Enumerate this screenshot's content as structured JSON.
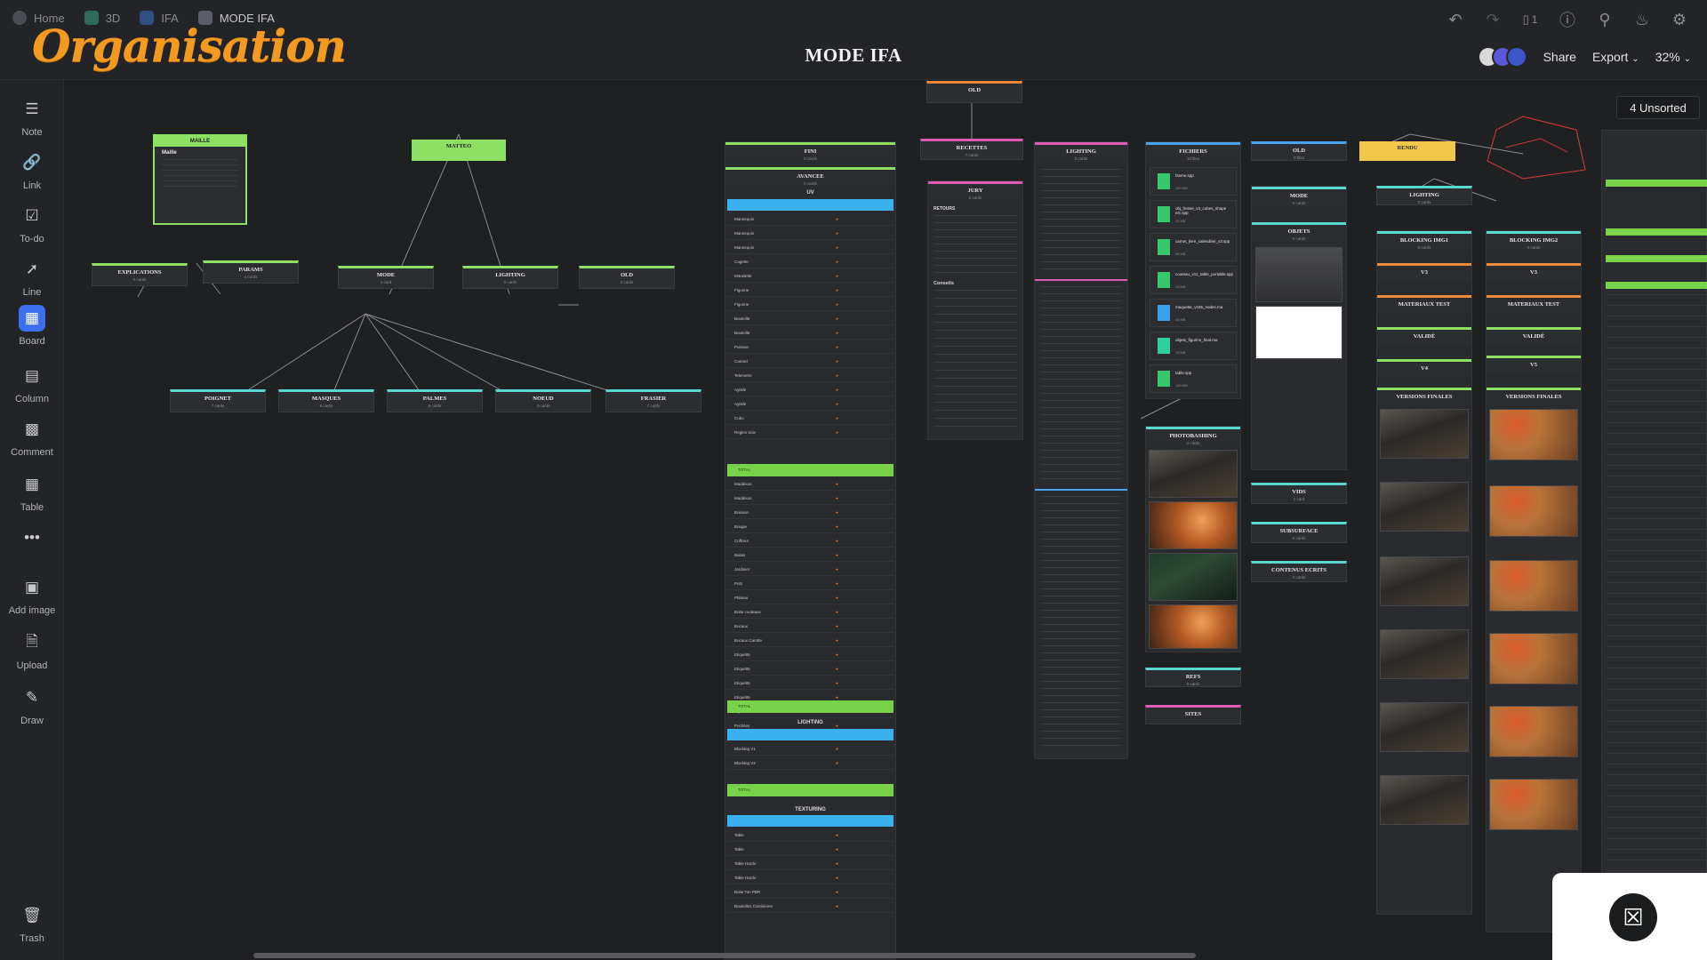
{
  "app": {
    "logo_text": "Organisation",
    "board_title": "MODE IFA",
    "breadcrumbs": [
      "Home",
      "3D",
      "IFA",
      "MODE IFA"
    ],
    "share_label": "Share",
    "export_label": "Export",
    "zoom": "32%",
    "device_count": "1",
    "unsorted_label": "4 Unsorted"
  },
  "toolbar": [
    {
      "label": "Note",
      "icon": "note-icon"
    },
    {
      "label": "Link",
      "icon": "link-icon"
    },
    {
      "label": "To-do",
      "icon": "todo-icon"
    },
    {
      "label": "Line",
      "icon": "line-icon"
    },
    {
      "label": "Board",
      "icon": "board-icon"
    },
    {
      "label": "Column",
      "icon": "column-icon"
    },
    {
      "label": "Comment",
      "icon": "comment-icon"
    },
    {
      "label": "Table",
      "icon": "table-icon"
    },
    {
      "label": "Add image",
      "icon": "add-image-icon"
    },
    {
      "label": "Upload",
      "icon": "upload-icon"
    },
    {
      "label": "Draw",
      "icon": "draw-icon"
    },
    {
      "label": "Trash",
      "icon": "trash-icon"
    }
  ],
  "mindmap": {
    "maille": {
      "title": "MAILLE",
      "sub": "Maille"
    },
    "matteo": {
      "title": "MATTEO"
    },
    "explications": {
      "title": "EXPLICATIONS",
      "sub": "0 cards"
    },
    "params": {
      "title": "PARAMS",
      "sub": "4 cards"
    },
    "mode": {
      "title": "MODE",
      "sub": "1 card"
    },
    "lighting": {
      "title": "LIGHTING",
      "sub": "0 cards"
    },
    "old": {
      "title": "OLD",
      "sub": "2 cards"
    },
    "poignet": {
      "title": "POIGNET",
      "sub": "7 cards"
    },
    "masques": {
      "title": "MASQUES",
      "sub": "8 cards"
    },
    "palmes": {
      "title": "PALMES",
      "sub": "8 cards"
    },
    "noeud": {
      "title": "NOEUD",
      "sub": "3 cards"
    },
    "frasier": {
      "title": "FRASIER",
      "sub": "7 cards"
    }
  },
  "columns": {
    "fini": {
      "title": "FINI",
      "sub": "0 cards"
    },
    "avancee": {
      "title": "AVANCEE",
      "sub": "0 cards"
    },
    "uv": "UV",
    "lighting": "LIGHTING",
    "texturing": "TEXTURING",
    "total": "TOTAL",
    "recettes": {
      "title": "RECETTES",
      "sub": "7 cards"
    },
    "jury": {
      "title": "JURY",
      "sub": "2 cards"
    },
    "retours": "RETOURS",
    "conseils": "Conseils",
    "lighting_col": {
      "title": "LIGHTING",
      "sub": "0 cards"
    },
    "fichiers": {
      "title": "FICHIERS",
      "sub": "10 files"
    },
    "old": {
      "title": "OLD",
      "sub": "0 files"
    },
    "rendu": {
      "title": "RENDU",
      "sub": "0 cards"
    },
    "mode": {
      "title": "MODE",
      "sub": "0 cards"
    },
    "objets": {
      "title": "OBJETS",
      "sub": "0 cards"
    },
    "photobashing": {
      "title": "PHOTOBASHING",
      "sub": "4 cards"
    },
    "refs": {
      "title": "REFS",
      "sub": "0 cards"
    },
    "vids": {
      "title": "VIDS",
      "sub": "1 card"
    },
    "subsurface": {
      "title": "SUBSURFACE",
      "sub": "0 cards"
    },
    "contenus_ecrits": {
      "title": "CONTENUS ECRITS",
      "sub": "0 cards"
    },
    "lighting2": {
      "title": "LIGHTING",
      "sub": "0 cards"
    },
    "blocking_img1": {
      "title": "BLOCKING IMG1",
      "sub": "0 cards"
    },
    "blocking_img2": {
      "title": "BLOCKING IMG2",
      "sub": "0 cards"
    },
    "v3": {
      "title": "V3",
      "sub": "0 cards"
    },
    "materiaux_test": {
      "title": "MATERIAUX TEST",
      "sub": "0 cards"
    },
    "valide": {
      "title": "VALIDÉ",
      "sub": "1 card"
    },
    "v4": {
      "title": "V4",
      "sub": "0 cards"
    },
    "v5": {
      "title": "V5",
      "sub": "0 cards"
    },
    "versions_finales": {
      "title": "VERSIONS FINALES",
      "sub": "0 cards"
    }
  },
  "files": [
    {
      "name": "fasme.spp",
      "size": "120 MB",
      "type": "green"
    },
    {
      "name": "obj_fresse_v3_cubes_shape etc.spp",
      "size": "12 MB",
      "type": "green"
    },
    {
      "name": "carnet_livre_calendrier_v3.spp",
      "size": "98 MB",
      "type": "green"
    },
    {
      "name": "couteau_v11_table_portable.spp",
      "size": "14 MB",
      "type": "green"
    },
    {
      "name": "maquette_v155_nodes.ma",
      "size": "40 MB",
      "type": "blue"
    },
    {
      "name": "objets_figurine_final.ma",
      "size": "78 MB",
      "type": "mint"
    },
    {
      "name": "table.spp",
      "size": "100 MB",
      "type": "green"
    }
  ],
  "table_rows": [
    "Mannequin",
    "Mannequin",
    "Mannequin",
    "Cagette",
    "Mitrailette",
    "Figurine",
    "Figurine",
    "Bouteille",
    "Bouteille",
    "Poisson",
    "Canard",
    "Telemetre",
    "Agrafe",
    "Agrafe",
    "Cubo",
    "Regles Scie"
  ],
  "table_rows2": [
    "Maddison",
    "Maddison",
    "Boisson",
    "Bougie",
    "Coffreur",
    "Balais",
    "Jardinier",
    "Pots",
    "Plateau",
    "Boite couteaux",
    "Bocaux",
    "Bocaux Carotte",
    "Etiquette",
    "Etiquette",
    "Etiquette",
    "Etiquette",
    "Styles",
    "Pochites"
  ],
  "lighting_rows": [
    "Blocking V1",
    "Blocking V2"
  ],
  "texturing_rows": [
    "Table",
    "Table",
    "Table Hardo",
    "Table Hardo",
    "Boite Ton PBR",
    "Bouteilles Cuisinieres"
  ]
}
